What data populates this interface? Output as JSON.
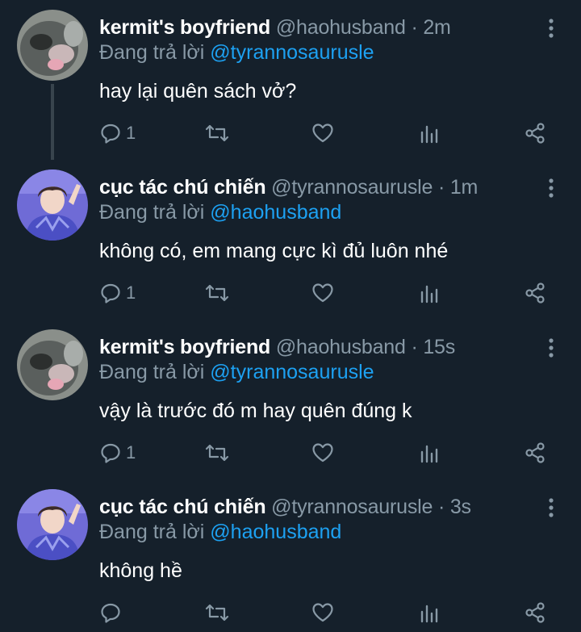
{
  "colors": {
    "background": "#15202b",
    "name": "#ffffff",
    "secondary": "#8899a6",
    "mention": "#1da1f2",
    "thread_line": "#38444d"
  },
  "tweets": [
    {
      "name": "kermit's boyfriend",
      "handle": "@haohusband",
      "separator": "·",
      "time": "2m",
      "reply_prefix": "Đang trả lời",
      "reply_to": "@tyrannosaurusle",
      "text": "hay lại quên sách vở?",
      "reply_count": "1",
      "avatar": "cat-avatar"
    },
    {
      "name": "cục tác chú chiến",
      "handle": "@tyrannosaurusle",
      "separator": "·",
      "time": "1m",
      "reply_prefix": "Đang trả lời",
      "reply_to": "@haohusband",
      "text": "không có, em mang cực kì đủ luôn nhé",
      "reply_count": "1",
      "avatar": "person-avatar"
    },
    {
      "name": "kermit's boyfriend",
      "handle": "@haohusband",
      "separator": "·",
      "time": "15s",
      "reply_prefix": "Đang trả lời",
      "reply_to": "@tyrannosaurusle",
      "text": "vậy là trước đó m hay quên đúng k",
      "reply_count": "1",
      "avatar": "cat-avatar"
    },
    {
      "name": "cục tác chú chiến",
      "handle": "@tyrannosaurusle",
      "separator": "·",
      "time": "3s",
      "reply_prefix": "Đang trả lời",
      "reply_to": "@haohusband",
      "text": "không hề",
      "reply_count": "",
      "avatar": "person-avatar"
    }
  ],
  "icons": {
    "reply": "reply-icon",
    "retweet": "retweet-icon",
    "like": "heart-icon",
    "analytics": "analytics-icon",
    "share": "share-icon",
    "more": "more-vertical-icon"
  }
}
